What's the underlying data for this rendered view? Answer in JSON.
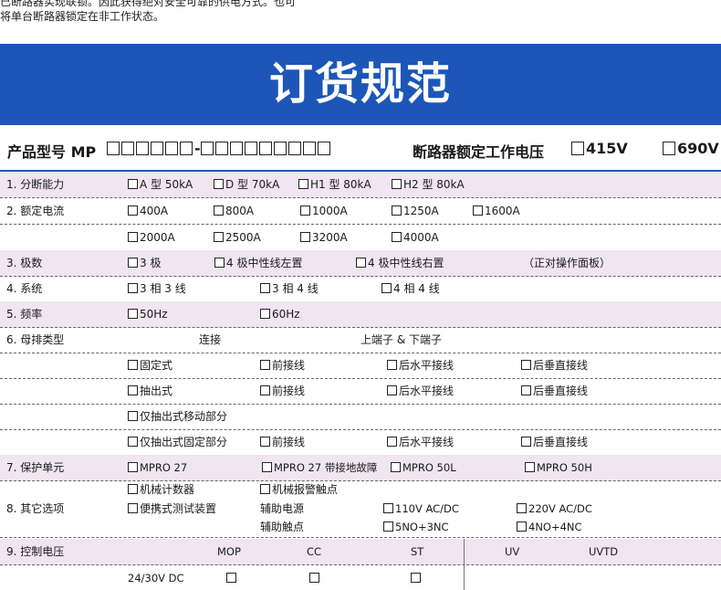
{
  "intro": {
    "line1": "已断路器实现联锁。因此获得绝对安全可靠的供电方式。也可",
    "line2": "将单台断路器锁定在非工作状态。"
  },
  "banner": {
    "title": "订货规范"
  },
  "model": {
    "label": "产品型号 MP",
    "dash": "-",
    "voltage_label": "断路器额定工作电压",
    "v1": "415V",
    "v2": "690V"
  },
  "rows": {
    "breaking": {
      "label": "1. 分断能力",
      "opts": [
        "A 型 50kA",
        "D 型 70kA",
        "H1 型 80kA",
        "H2 型 80kA"
      ]
    },
    "current": {
      "label": "2. 额定电流",
      "opts1": [
        "400A",
        "800A",
        "1000A",
        "1250A",
        "1600A"
      ],
      "opts2": [
        "2000A",
        "2500A",
        "3200A",
        "4000A"
      ]
    },
    "poles": {
      "label": "3. 极数",
      "opts": [
        "3 极",
        "4 极中性线左置",
        "4 极中性线右置"
      ],
      "note": "（正对操作面板）"
    },
    "system": {
      "label": "4. 系统",
      "opts": [
        "3 相 3 线",
        "3 相 4 线",
        "4 相 4 线"
      ]
    },
    "freq": {
      "label": "5. 频率",
      "opts": [
        "50Hz",
        "60Hz"
      ]
    },
    "busbar": {
      "label": "6. 母排类型",
      "head_connect": "连接",
      "head_terminal": "上端子 & 下端子",
      "fixed": "固定式",
      "drawout": "抽出式",
      "moving_only": "仅抽出式移动部分",
      "fixed_only": "仅抽出式固定部分",
      "front": "前接线",
      "rear_h": "后水平接线",
      "rear_v": "后垂直接线"
    },
    "protect": {
      "label": "7. 保护单元",
      "opts": [
        "MPRO 27",
        "MPRO 27 带接地故障",
        "MPRO 50L",
        "MPRO 50H"
      ]
    },
    "other": {
      "label": "8. 其它选项",
      "counter": "机械计数器",
      "alarm": "机械报警触点",
      "tester": "便携式测试装置",
      "aux_power": "辅助电源",
      "ac110": "110V AC/DC",
      "ac220": "220V AC/DC",
      "aux_contact": "辅助触点",
      "no5": "5NO+3NC",
      "no4": "4NO+4NC"
    },
    "control": {
      "label": "9. 控制电压",
      "cols": [
        "MOP",
        "CC",
        "ST",
        "UV",
        "UVTD"
      ],
      "dc": "24/30V DC"
    }
  }
}
